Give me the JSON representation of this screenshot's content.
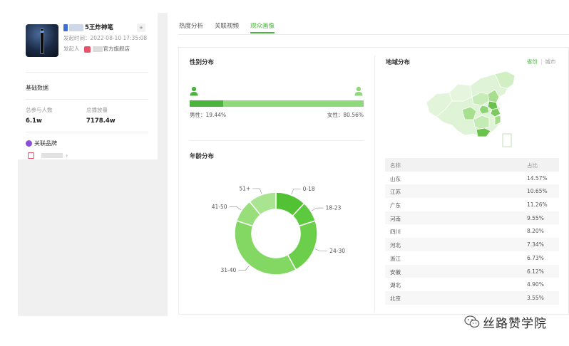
{
  "video": {
    "title": "5王炸神笔",
    "date": "发起时间：2022-08-10 17:35:08",
    "author_label": "发起人",
    "author_shop": "官方旗舰店"
  },
  "basic_data": {
    "title": "基础数据",
    "participants_label": "总参与人数",
    "participants_value": "6.1w",
    "plays_label": "总播放量",
    "plays_value": "7178.4w"
  },
  "brand": {
    "title": "关联品牌"
  },
  "tabs": [
    {
      "label": "热度分析"
    },
    {
      "label": "关联视频"
    },
    {
      "label": "观众画像"
    }
  ],
  "gender": {
    "title": "性别分布",
    "male_label": "男性：19.44%",
    "female_label": "女性：80.56%",
    "male_pct": 19.44,
    "female_pct": 80.56,
    "male_color": "#4ab43c",
    "female_color": "#8fd97a"
  },
  "age": {
    "title": "年龄分布",
    "segments": [
      {
        "label": "0-18",
        "value": 12,
        "color": "#52c234"
      },
      {
        "label": "18-23",
        "value": 8,
        "color": "#5dc93e"
      },
      {
        "label": "24-30",
        "value": 22,
        "color": "#6ccf4b"
      },
      {
        "label": "31-40",
        "value": 38,
        "color": "#82d862"
      },
      {
        "label": "41-50",
        "value": 9,
        "color": "#98df7c"
      },
      {
        "label": "51+",
        "value": 11,
        "color": "#a9e591"
      }
    ]
  },
  "region": {
    "title": "地域分布",
    "toggle_on": "省份",
    "toggle_off": "城市",
    "header": {
      "name": "名称",
      "ratio": "占比"
    },
    "rows": [
      {
        "name": "山东",
        "ratio": "14.57%"
      },
      {
        "name": "江苏",
        "ratio": "10.65%"
      },
      {
        "name": "广东",
        "ratio": "11.26%"
      },
      {
        "name": "河南",
        "ratio": "9.55%"
      },
      {
        "name": "四川",
        "ratio": "8.20%"
      },
      {
        "name": "河北",
        "ratio": "7.34%"
      },
      {
        "name": "浙江",
        "ratio": "6.73%"
      },
      {
        "name": "安徽",
        "ratio": "6.12%"
      },
      {
        "name": "湖北",
        "ratio": "4.90%"
      },
      {
        "name": "北京",
        "ratio": "3.55%"
      }
    ]
  },
  "watermark": {
    "text": "丝路赞学院"
  },
  "icons": {
    "star": "star-icon",
    "male": "male-person-icon",
    "female": "female-person-icon",
    "brand": "brand-icon",
    "gift": "gift-icon",
    "chevron": "chevron-right-icon",
    "wechat": "wechat-icon"
  }
}
